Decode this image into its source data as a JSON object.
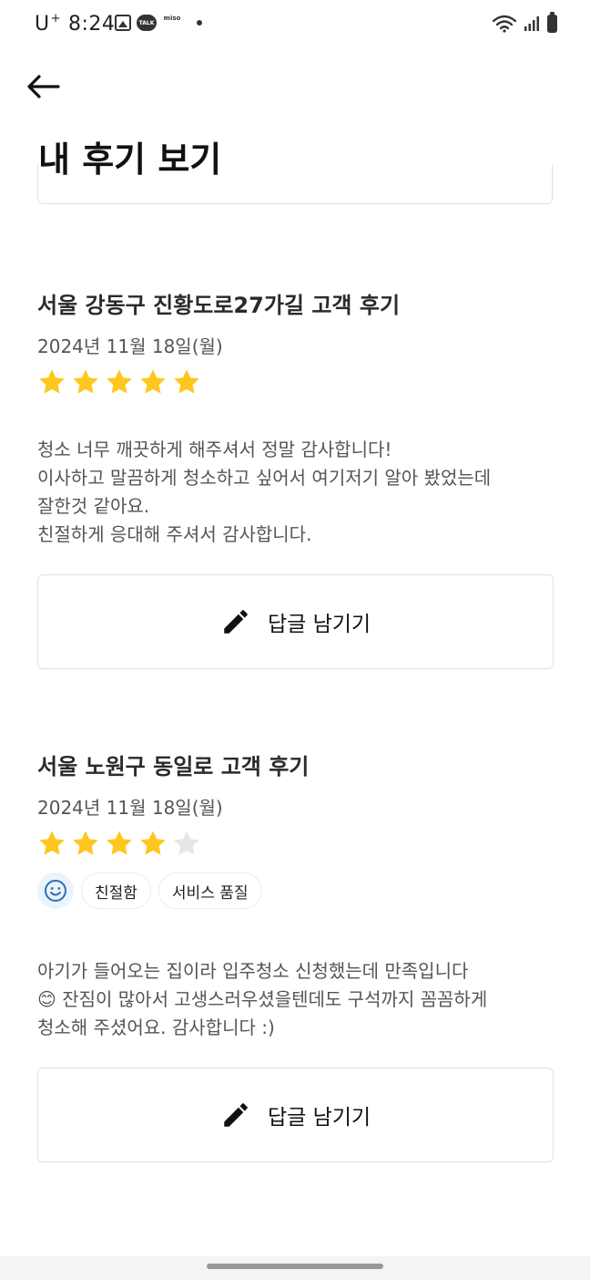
{
  "status_bar": {
    "carrier": "U",
    "carrier_sup": "+",
    "time": "8:24",
    "talk_badge": "TALK",
    "miso_badge": "miso"
  },
  "header": {
    "title": "내 후기 보기"
  },
  "reviews": [
    {
      "title": "서울 강동구 진황도로27가길 고객 후기",
      "date": "2024년 11월 18일(월)",
      "rating": 5,
      "body": "청소 너무 깨끗하게 해주셔서 정말 감사합니다!\n이사하고 말끔하게 청소하고 싶어서 여기저기 알아 봤었는데\n잘한것 같아요.\n친절하게 응대해 주셔서 감사합니다.",
      "reply_label": "답글 남기기"
    },
    {
      "title": "서울 노원구 동일로 고객 후기",
      "date": "2024년 11월 18일(월)",
      "rating": 4,
      "tags": [
        "친절함",
        "서비스 품질"
      ],
      "body": "아기가 들어오는 집이라 입주청소 신청했는데 만족입니다\n😊 잔짐이 많아서 고생스러우셨을텐데도 구석까지 꼼꼼하게\n청소해 주셨어요. 감사합니다 :)",
      "reply_label": "답글 남기기"
    }
  ],
  "colors": {
    "star_filled": "#FFC71E",
    "star_empty": "#E6E6E6",
    "smile_icon": "#2F6DB5"
  }
}
